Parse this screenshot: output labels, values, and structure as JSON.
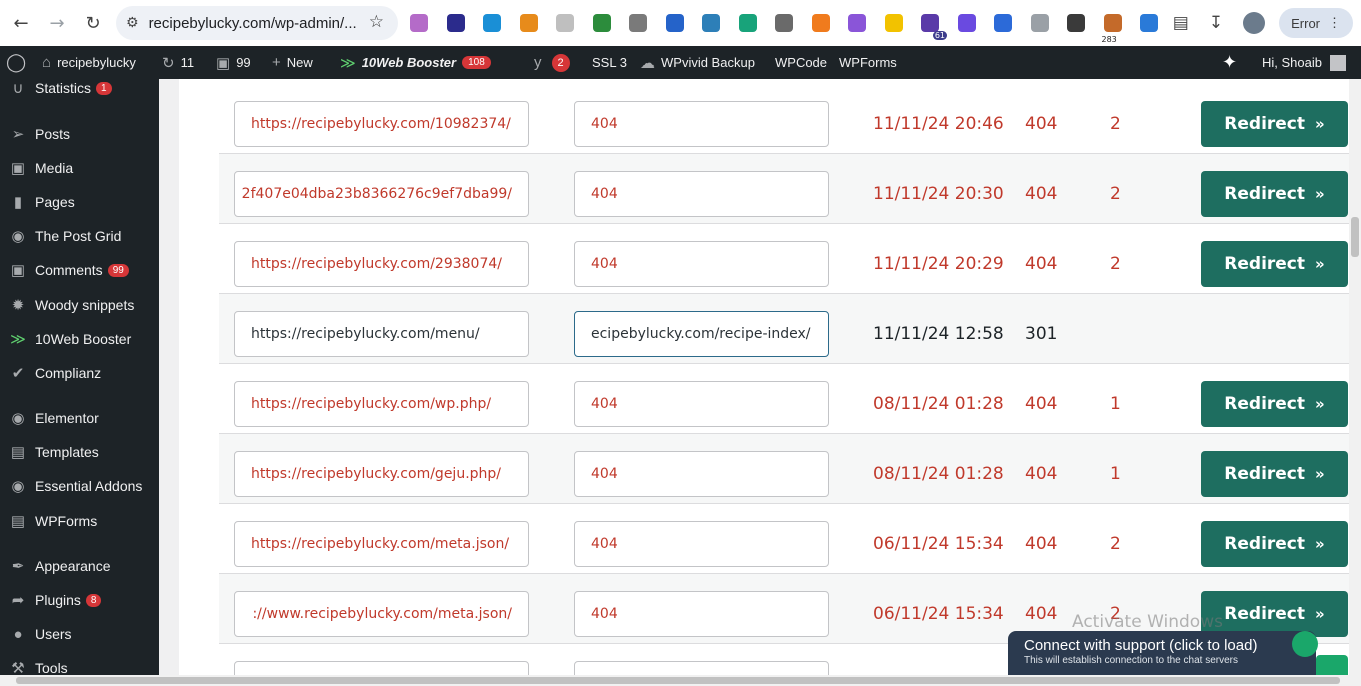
{
  "browser": {
    "url": "recipebylucky.com/wp-admin/...",
    "error_label": "Error",
    "extensions": [
      {
        "name": "ext-a",
        "color": "#b46bc8"
      },
      {
        "name": "ext-b",
        "color": "#2b2b8c"
      },
      {
        "name": "ext-c",
        "color": "#1a8fd6"
      },
      {
        "name": "ext-d",
        "color": "#e78b1b"
      },
      {
        "name": "ext-e",
        "color": "#bfbfbf"
      },
      {
        "name": "ext-f",
        "color": "#2c8c3c"
      },
      {
        "name": "ext-g",
        "color": "#7a7a7a"
      },
      {
        "name": "ext-h",
        "color": "#2563c9"
      },
      {
        "name": "ext-i",
        "color": "#2d7fb8"
      },
      {
        "name": "ext-j",
        "color": "#18a37a"
      },
      {
        "name": "ext-k",
        "color": "#6a6a6a"
      },
      {
        "name": "ext-l",
        "color": "#f07b1d"
      },
      {
        "name": "ext-m",
        "color": "#8a55d8"
      },
      {
        "name": "ext-n",
        "color": "#f2c200"
      },
      {
        "name": "ext-o",
        "color": "#5a3aa8",
        "badge": "61"
      },
      {
        "name": "ext-p",
        "color": "#6a4ae0"
      },
      {
        "name": "ext-q",
        "color": "#2c6ad8"
      },
      {
        "name": "ext-r",
        "color": "#9aa0a6"
      },
      {
        "name": "ext-s",
        "color": "#3a3a3a"
      },
      {
        "name": "ext-t",
        "color": "#c46a2a",
        "badge2": "283"
      },
      {
        "name": "ext-u",
        "color": "#2a7ad8"
      }
    ]
  },
  "adminbar": {
    "site": "recipebylucky",
    "updates": "11",
    "comments": "99",
    "new": "New",
    "booster": "10Web Booster",
    "booster_count": "108",
    "yoast_count": "2",
    "ssl": "SSL 3",
    "wpvivid": "WPvivid Backup",
    "wpcode": "WPCode",
    "wpforms": "WPForms",
    "greeting": "Hi, Shoaib"
  },
  "sidebar": {
    "items": [
      {
        "label": "Statistics",
        "icon": "chart-icon",
        "count": "1"
      },
      {
        "label": "Posts",
        "icon": "pin-icon"
      },
      {
        "label": "Media",
        "icon": "media-icon"
      },
      {
        "label": "Pages",
        "icon": "page-icon"
      },
      {
        "label": "The Post Grid",
        "icon": "grid-icon"
      },
      {
        "label": "Comments",
        "icon": "comment-icon",
        "count": "99"
      },
      {
        "label": "Woody snippets",
        "icon": "snippet-icon"
      },
      {
        "label": "10Web Booster",
        "icon": "booster-icon"
      },
      {
        "label": "Complianz",
        "icon": "check-icon"
      },
      {
        "label": "Elementor",
        "icon": "elementor-icon"
      },
      {
        "label": "Templates",
        "icon": "folder-icon"
      },
      {
        "label": "Essential Addons",
        "icon": "ea-icon"
      },
      {
        "label": "WPForms",
        "icon": "forms-icon"
      },
      {
        "label": "Appearance",
        "icon": "brush-icon"
      },
      {
        "label": "Plugins",
        "icon": "plugin-icon",
        "count": "8"
      },
      {
        "label": "Users",
        "icon": "user-icon"
      },
      {
        "label": "Tools",
        "icon": "tools-icon"
      }
    ]
  },
  "table": {
    "redirect_label": "Redirect",
    "redirect_arrow": "»",
    "rows": [
      {
        "source": "https://recipebylucky.com/10982374/",
        "target": "404",
        "date": "11/11/24 20:46",
        "code": "404",
        "hits": "2",
        "action": true
      },
      {
        "source": "2f407e04dba23b8366276c9ef7dba99/",
        "target": "404",
        "date": "11/11/24 20:30",
        "code": "404",
        "hits": "2",
        "action": true
      },
      {
        "source": "https://recipebylucky.com/2938074/",
        "target": "404",
        "date": "11/11/24 20:29",
        "code": "404",
        "hits": "2",
        "action": true
      },
      {
        "source": "https://recipebylucky.com/menu/",
        "target": "ecipebylucky.com/recipe-index/",
        "date": "11/11/24 12:58",
        "code": "301",
        "hits": "",
        "action": false
      },
      {
        "source": "https://recipebylucky.com/wp.php/",
        "target": "404",
        "date": "08/11/24 01:28",
        "code": "404",
        "hits": "1",
        "action": true
      },
      {
        "source": "https://recipebylucky.com/geju.php/",
        "target": "404",
        "date": "08/11/24 01:28",
        "code": "404",
        "hits": "1",
        "action": true
      },
      {
        "source": "https://recipebylucky.com/meta.json/",
        "target": "404",
        "date": "06/11/24 15:34",
        "code": "404",
        "hits": "2",
        "action": true
      },
      {
        "source": "://www.recipebylucky.com/meta.json/",
        "target": "404",
        "date": "06/11/24 15:34",
        "code": "404",
        "hits": "2",
        "action": true
      }
    ]
  },
  "watermark": "Activate Windows",
  "chat": {
    "title": "Connect with support (click to load)",
    "subtitle": "This will establish connection to the chat servers"
  }
}
